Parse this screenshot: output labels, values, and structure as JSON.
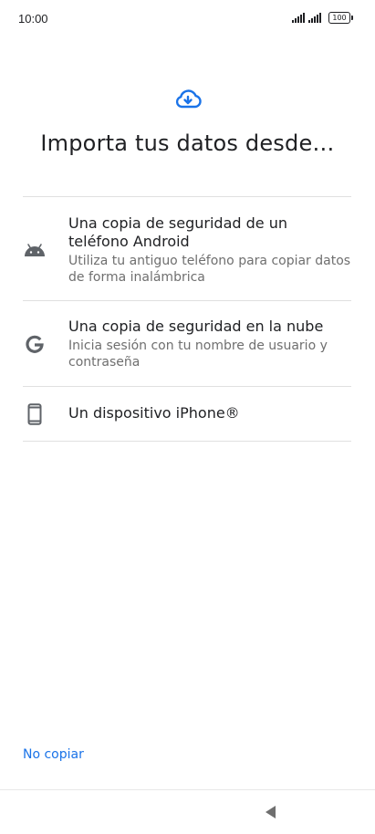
{
  "status_bar": {
    "time": "10:00",
    "battery": "100"
  },
  "header": {
    "icon": "cloud-download-icon",
    "title": "Importa tus datos desde…"
  },
  "options": [
    {
      "icon": "android-icon",
      "title": "Una copia de seguridad de un teléfono Android",
      "subtitle": "Utiliza tu antiguo teléfono para copiar datos de forma inalámbrica"
    },
    {
      "icon": "google-icon",
      "title": "Una copia de seguridad en la nube",
      "subtitle": "Inicia sesión con tu nombre de usuario y contraseña"
    },
    {
      "icon": "smartphone-icon",
      "title": "Un dispositivo iPhone®"
    }
  ],
  "footer": {
    "skip_label": "No copiar"
  },
  "navigation": {
    "back_icon": "back-triangle-icon"
  },
  "colors": {
    "accent": "#1a73e8",
    "icon_gray": "#5f6368",
    "divider": "#e0e0e0"
  }
}
